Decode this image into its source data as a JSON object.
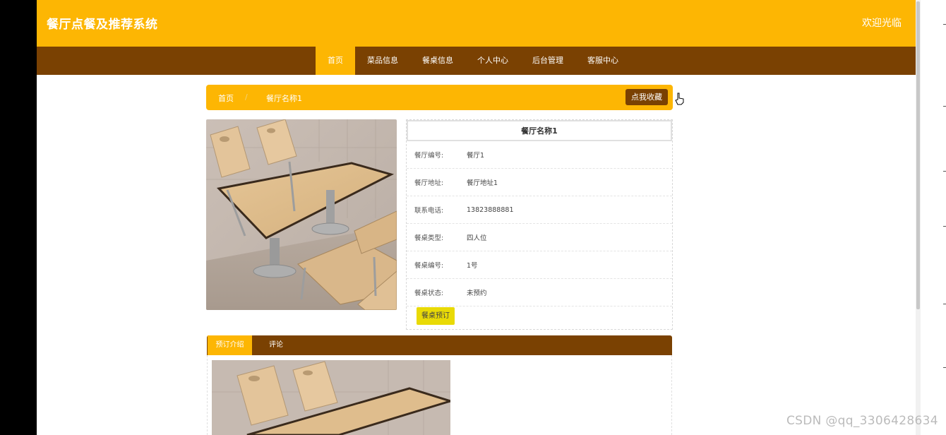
{
  "header": {
    "site_title": "餐厅点餐及推荐系统",
    "welcome": "欢迎光临"
  },
  "nav": {
    "items": [
      {
        "label": "首页",
        "active": true
      },
      {
        "label": "菜品信息",
        "active": false
      },
      {
        "label": "餐桌信息",
        "active": false
      },
      {
        "label": "个人中心",
        "active": false
      },
      {
        "label": "后台管理",
        "active": false
      },
      {
        "label": "客服中心",
        "active": false
      }
    ]
  },
  "breadcrumb": {
    "home": "首页",
    "separator": "/",
    "current": "餐厅名称1",
    "favorite_button": "点我收藏"
  },
  "detail": {
    "title": "餐厅名称1",
    "rows": [
      {
        "label": "餐厅编号:",
        "value": "餐厅1"
      },
      {
        "label": "餐厅地址:",
        "value": "餐厅地址1"
      },
      {
        "label": "联系电话:",
        "value": "13823888881"
      },
      {
        "label": "餐桌类型:",
        "value": "四人位"
      },
      {
        "label": "餐桌编号:",
        "value": "1号"
      },
      {
        "label": "餐桌状态:",
        "value": "未预约"
      }
    ],
    "reserve_button": "餐桌预订"
  },
  "tabs": {
    "items": [
      "预订介绍",
      "评论"
    ],
    "active_index": 0
  },
  "colors": {
    "primary_yellow": "#fdb603",
    "primary_brown": "#7a4102",
    "reserve_button": "#e9da06"
  },
  "watermark": "CSDN @qq_3306428634"
}
